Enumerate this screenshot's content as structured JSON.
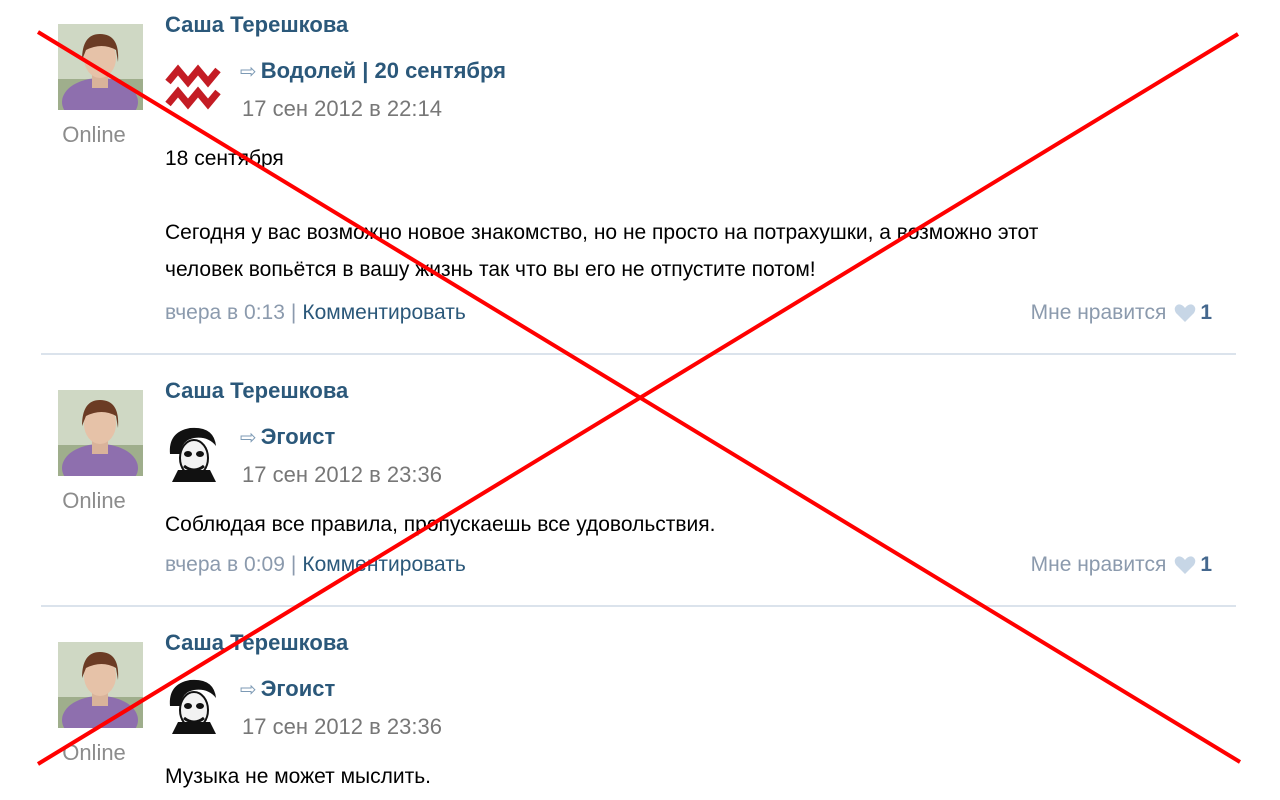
{
  "posts": [
    {
      "author": "Саша Терешкова",
      "status": "Online",
      "group_name": "Водолей | 20 сентября",
      "group_icon": "aquarius-icon",
      "date": "17 сен 2012 в 22:14",
      "text_lines": [
        "18 сентября",
        "",
        "Сегодня у вас возможно новое знакомство, но не просто на потрахушки, а возможно этот",
        "человек вопьётся в вашу жизнь так что вы его не отпустите потом!"
      ],
      "time": "вчера в 0:13",
      "comment_label": "Комментировать",
      "like_label": "Мне нравится",
      "like_count": "1"
    },
    {
      "author": "Саша Терешкова",
      "status": "Online",
      "group_name": "Эгоист",
      "group_icon": "joker-avatar-icon",
      "date": "17 сен 2012 в 23:36",
      "text_lines": [
        "Соблюдая все правила, пропускаешь все удовольствия."
      ],
      "time": "вчера в 0:09",
      "comment_label": "Комментировать",
      "like_label": "Мне нравится",
      "like_count": "1"
    },
    {
      "author": "Саша Терешкова",
      "status": "Online",
      "group_name": "Эгоист",
      "group_icon": "joker-avatar-icon",
      "date": "17 сен 2012 в 23:36",
      "text_lines": [
        "Музыка не может мыслить."
      ]
    }
  ],
  "colors": {
    "link": "#2b587a",
    "muted": "#8b9aad",
    "cross": "#ff0000",
    "divider": "#dbe3ec"
  }
}
